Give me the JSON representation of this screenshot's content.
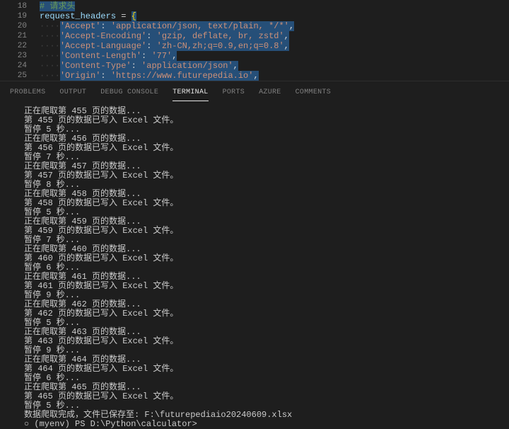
{
  "editor": {
    "lines": [
      {
        "num": "18",
        "html": "<span class='selection'><span class='hl-comment'># 请求头</span></span>"
      },
      {
        "num": "19",
        "html": "<span class='hl-var'>request_headers</span> <span class='hl-op'>=</span> <span class='selection'><span class='hl-brace'>{</span></span>"
      },
      {
        "num": "20",
        "html": "<span class='hl-whitespace'>····</span><span class='selection'><span class='hl-string'>'Accept'</span><span class='hl-op'>: </span><span class='hl-string'>'application/json, text/plain, */*'</span><span class='hl-op'>,</span></span>"
      },
      {
        "num": "21",
        "html": "<span class='hl-whitespace'>····</span><span class='selection'><span class='hl-string'>'Accept-Encoding'</span><span class='hl-op'>: </span><span class='hl-string'>'gzip, deflate, br, zstd'</span><span class='hl-op'>,</span></span>"
      },
      {
        "num": "22",
        "html": "<span class='hl-whitespace'>····</span><span class='selection'><span class='hl-string'>'Accept-Language'</span><span class='hl-op'>: </span><span class='hl-string'>'zh-CN,zh;q=0.9,en;q=0.8'</span><span class='hl-op'>,</span></span>"
      },
      {
        "num": "23",
        "html": "<span class='hl-whitespace'>····</span><span class='selection'><span class='hl-string'>'Content-Length'</span><span class='hl-op'>: </span><span class='hl-string'>'77'</span><span class='hl-op'>,</span></span>"
      },
      {
        "num": "24",
        "html": "<span class='hl-whitespace'>····</span><span class='selection'><span class='hl-string'>'Content-Type'</span><span class='hl-op'>: </span><span class='hl-string'>'application/json'</span><span class='hl-op'>,</span></span>"
      },
      {
        "num": "25",
        "html": "<span class='hl-whitespace'>····</span><span class='selection'><span class='hl-string'>'Origin'</span><span class='hl-op'>: </span><span class='hl-string'>'https://www.futurepedia.io'</span><span class='hl-op'>,</span></span>"
      }
    ]
  },
  "panel": {
    "tabs": [
      {
        "label": "PROBLEMS",
        "active": false
      },
      {
        "label": "OUTPUT",
        "active": false
      },
      {
        "label": "DEBUG CONSOLE",
        "active": false
      },
      {
        "label": "TERMINAL",
        "active": true
      },
      {
        "label": "PORTS",
        "active": false
      },
      {
        "label": "AZURE",
        "active": false
      },
      {
        "label": "COMMENTS",
        "active": false
      }
    ]
  },
  "terminal": {
    "lines": [
      "正在爬取第 455 页的数据...",
      "第 455 页的数据已写入 Excel 文件。",
      "暂停 5 秒...",
      "正在爬取第 456 页的数据...",
      "第 456 页的数据已写入 Excel 文件。",
      "暂停 7 秒...",
      "正在爬取第 457 页的数据...",
      "第 457 页的数据已写入 Excel 文件。",
      "暂停 8 秒...",
      "正在爬取第 458 页的数据...",
      "第 458 页的数据已写入 Excel 文件。",
      "暂停 5 秒...",
      "正在爬取第 459 页的数据...",
      "第 459 页的数据已写入 Excel 文件。",
      "暂停 7 秒...",
      "正在爬取第 460 页的数据...",
      "第 460 页的数据已写入 Excel 文件。",
      "暂停 6 秒...",
      "正在爬取第 461 页的数据...",
      "第 461 页的数据已写入 Excel 文件。",
      "暂停 9 秒...",
      "正在爬取第 462 页的数据...",
      "第 462 页的数据已写入 Excel 文件。",
      "暂停 5 秒...",
      "正在爬取第 463 页的数据...",
      "第 463 页的数据已写入 Excel 文件。",
      "暂停 9 秒...",
      "正在爬取第 464 页的数据...",
      "第 464 页的数据已写入 Excel 文件。",
      "暂停 6 秒...",
      "正在爬取第 465 页的数据...",
      "第 465 页的数据已写入 Excel 文件。",
      "暂停 5 秒...",
      "数据爬取完成，文件已保存至: F:\\futurepediaio20240609.xlsx"
    ],
    "prompt": "○ (myenv) PS D:\\Python\\calculator> "
  }
}
